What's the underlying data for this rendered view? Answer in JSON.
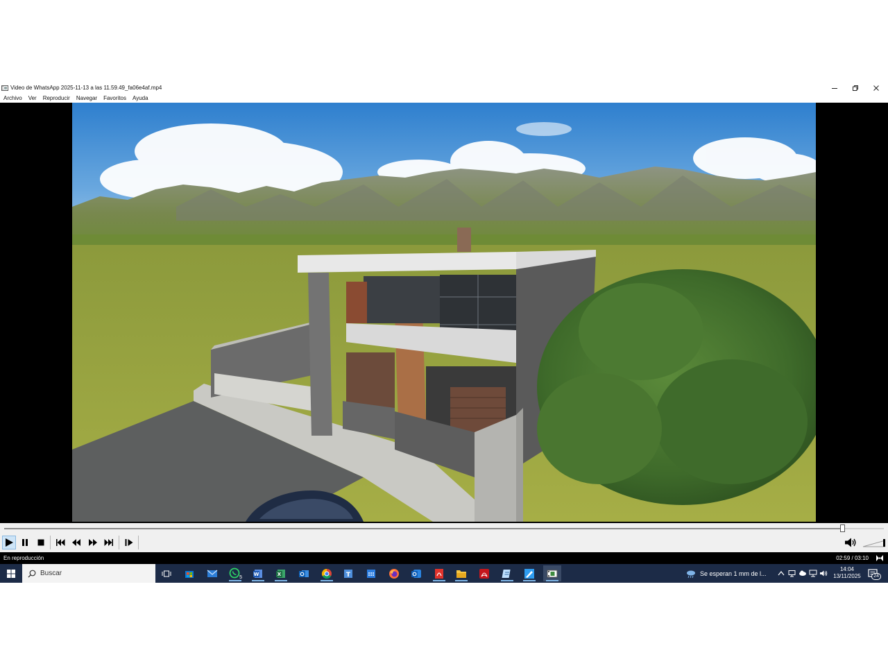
{
  "window": {
    "title": "Video de WhatsApp 2025-11-13 a las 11.59.49_fa06e4af.mp4",
    "minimize_icon": "minimize-icon",
    "maximize_icon": "restore-icon",
    "close_icon": "close-icon"
  },
  "menu": {
    "items": [
      "Archivo",
      "Ver",
      "Reproducir",
      "Navegar",
      "Favoritos",
      "Ayuda"
    ]
  },
  "playback": {
    "position": 0.9526,
    "state": "En reproducción",
    "time_display": "02:59 / 03:10",
    "volume": 0.95
  },
  "controls": {
    "icons": [
      "play-icon",
      "pause-icon",
      "stop-icon",
      "skip-previous-icon",
      "rewind-icon",
      "fast-forward-icon",
      "skip-next-icon",
      "frame-step-icon",
      "volume-icon"
    ]
  },
  "taskbar": {
    "search_placeholder": "Buscar",
    "apps": [
      "task-view",
      "microsoft-store",
      "mail",
      "whatsapp",
      "word",
      "excel",
      "outlook",
      "chrome",
      "teams",
      "calendar",
      "firefox",
      "outlook-new",
      "acrobat-document",
      "file-explorer",
      "acrobat",
      "notepad",
      "paint",
      "video-player"
    ],
    "whatsapp_badge": "5",
    "weather_text": "Se esperan 1 mm de l...",
    "clock_time": "14:04",
    "clock_date": "13/11/2025",
    "notification_count": "24"
  },
  "colors": {
    "taskbar_bg": "#1c2b47",
    "accent": "#0078d7",
    "status_bg": "#000000"
  }
}
